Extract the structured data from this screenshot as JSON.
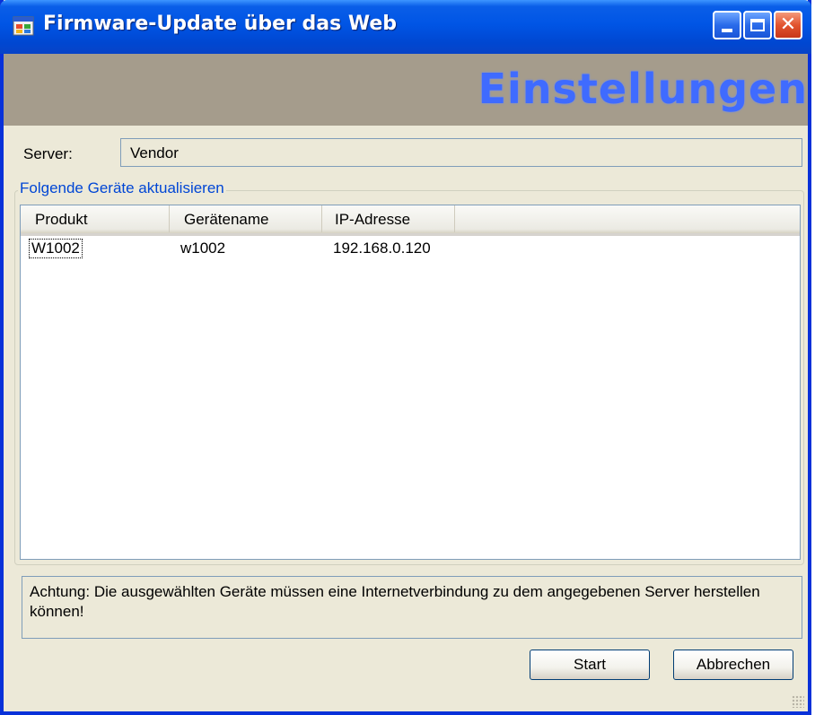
{
  "window": {
    "title": "Firmware-Update über das Web",
    "icon": "app-window-icon"
  },
  "titlebar_buttons": {
    "minimize_icon": "minimize-icon",
    "maximize_icon": "maximize-icon",
    "close_icon": "close-icon",
    "close_glyph": "✕"
  },
  "header": {
    "title": "Einstellungen"
  },
  "server": {
    "label": "Server:",
    "value": "Vendor"
  },
  "devices_group": {
    "legend": "Folgende Geräte aktualisieren",
    "columns": [
      "Produkt",
      "Gerätename",
      "IP-Adresse"
    ],
    "rows": [
      [
        "W1002",
        "w1002",
        "192.168.0.120"
      ]
    ]
  },
  "warning": {
    "text": "Achtung: Die ausgewählten Geräte müssen eine Internetverbindung zu dem angegebenen Server herstellen können!"
  },
  "buttons": {
    "start": "Start",
    "cancel": "Abbrechen"
  },
  "colors": {
    "titlebar": "#0055e5",
    "header_band": "#a59c8c",
    "header_text": "#3f6bff",
    "window_bg": "#ece9d8",
    "group_legend": "#0046d5"
  }
}
